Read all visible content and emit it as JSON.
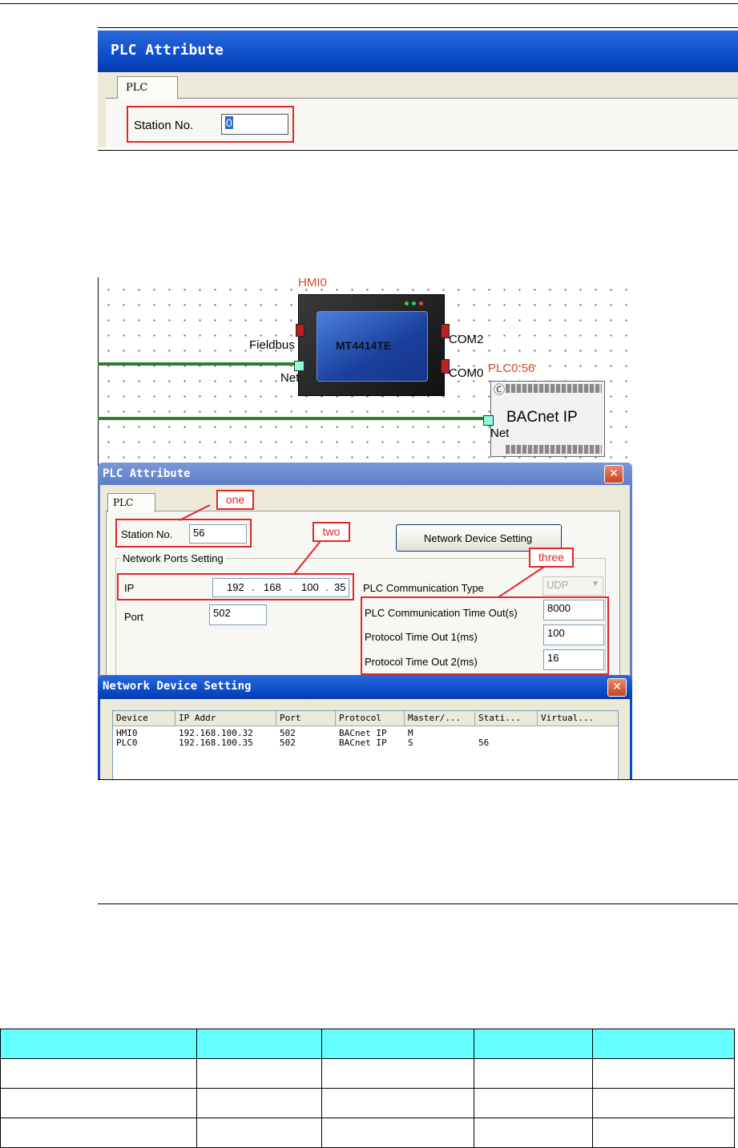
{
  "dialog1": {
    "title": "PLC Attribute",
    "tab": "PLC",
    "station_label": "Station No.",
    "station_value": "0"
  },
  "diagram": {
    "hmi_name": "HMI0",
    "hmi_model": "MT4414TE",
    "port_fieldbus": "Fieldbus",
    "port_net": "Net",
    "port_com2": "COM2",
    "port_com0": "COM0",
    "plc_name": "PLC0:56",
    "plc_label": "BACnet IP",
    "plc_net": "Net"
  },
  "dialog2": {
    "title": "PLC Attribute",
    "close": "✕",
    "tab": "PLC",
    "callout_one": "one",
    "callout_two": "two",
    "callout_three": "three",
    "station_label": "Station No.",
    "station_value": "56",
    "network_button": "Network Device Setting",
    "group_label": "Network Ports Setting",
    "ip_label": "IP",
    "ip_parts": [
      "192",
      "168",
      "100",
      "35"
    ],
    "port_label": "Port",
    "port_value": "502",
    "comm_type_label": "PLC Communication Type",
    "comm_type_value": "UDP",
    "timeout_label": "PLC Communication Time Out(s)",
    "timeout_value": "8000",
    "proto1_label": "Protocol Time Out 1(ms)",
    "proto1_value": "100",
    "proto2_label": "Protocol Time Out 2(ms)",
    "proto2_value": "16"
  },
  "dialog3": {
    "title": "Network Device Setting",
    "close": "✕",
    "columns": [
      "Device",
      "IP Addr",
      "Port",
      "Protocol",
      "Master/...",
      "Stati...",
      "Virtual..."
    ],
    "rows": [
      [
        "HMI0",
        "192.168.100.32",
        "502",
        "BACnet IP",
        "M",
        "",
        ""
      ],
      [
        "PLC0",
        "192.168.100.35",
        "502",
        "BACnet IP",
        "S",
        "56",
        ""
      ]
    ]
  },
  "table": {
    "header_color": "#66ffff",
    "columns": 5,
    "rows": 3
  }
}
